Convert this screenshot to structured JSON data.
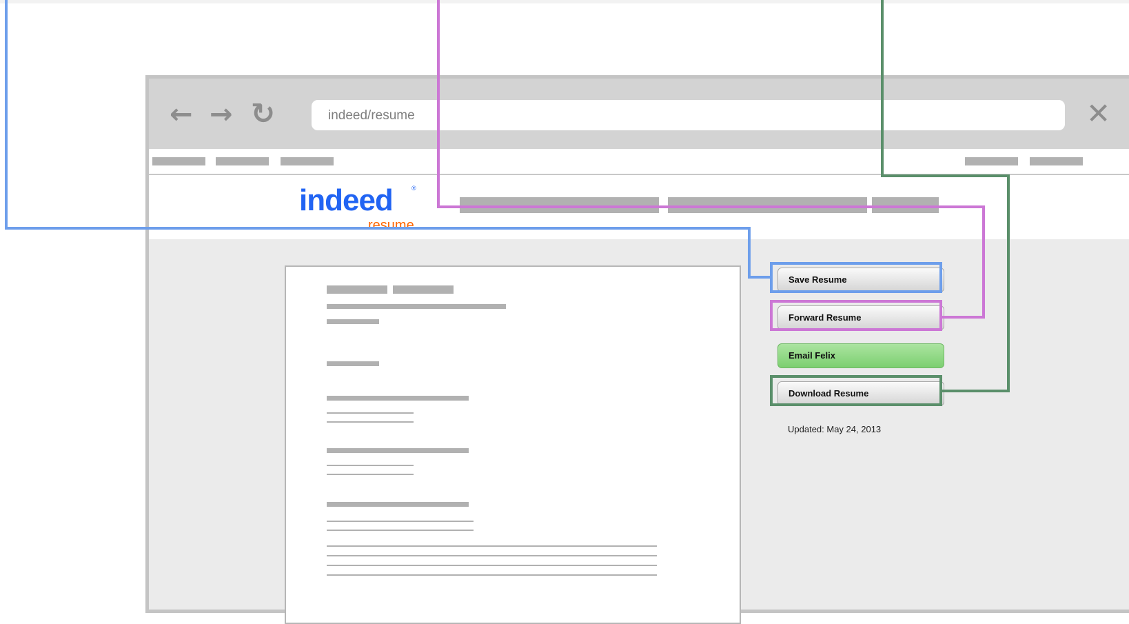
{
  "browser": {
    "url": "indeed/resume",
    "nav_icons": {
      "back": "arrow-left-icon",
      "forward": "arrow-right-icon",
      "reload": "reload-icon",
      "close": "close-icon"
    }
  },
  "logo": {
    "main": "indeed",
    "sub": "resume"
  },
  "actions": {
    "save": "Save Resume",
    "forward": "Forward Resume",
    "email": "Email Felix",
    "download": "Download Resume"
  },
  "updated": "Updated: May 24, 2013",
  "colors": {
    "save_highlight": "#6d9eeb",
    "forward_highlight": "#cc77d5",
    "download_highlight": "#5a8f6a",
    "email_button": "#8ed584",
    "logo_blue": "#2164f3",
    "logo_orange": "#ff6600"
  }
}
